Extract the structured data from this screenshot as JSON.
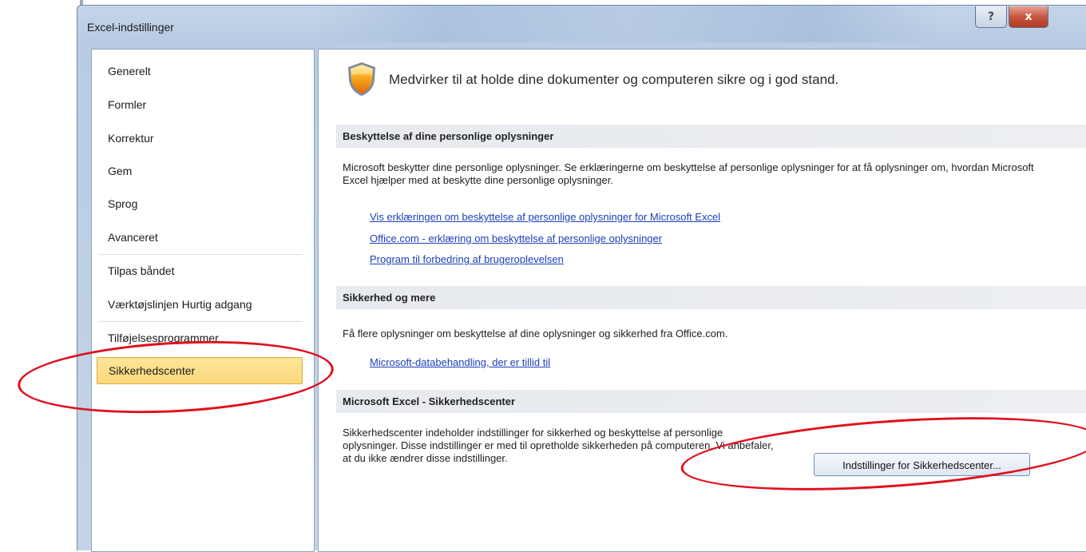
{
  "window": {
    "title": "Excel-indstillinger",
    "help_label": "?",
    "close_label": "x"
  },
  "sidebar": {
    "items": [
      {
        "label": "Generelt"
      },
      {
        "label": "Formler"
      },
      {
        "label": "Korrektur"
      },
      {
        "label": "Gem"
      },
      {
        "label": "Sprog"
      },
      {
        "label": "Avanceret"
      },
      {
        "label": "Tilpas båndet"
      },
      {
        "label": "Værktøjslinjen Hurtig adgang"
      },
      {
        "label": "Tilføjelsesprogrammer"
      },
      {
        "label": "Sikkerhedscenter"
      }
    ],
    "selected": "Sikkerhedscenter"
  },
  "content": {
    "header": "Medvirker til at holde dine dokumenter og computeren sikre og i god stand.",
    "sections": [
      {
        "title": "Beskyttelse af dine personlige oplysninger",
        "text": "Microsoft beskytter dine personlige oplysninger. Se erklæringerne om beskyttelse af personlige oplysninger for at få oplysninger om, hvordan Microsoft Excel hjælper med at beskytte dine personlige oplysninger.",
        "links": [
          "Vis erklæringen om beskyttelse af personlige oplysninger for Microsoft Excel",
          "Office.com - erklæring om beskyttelse af personlige oplysninger",
          "Program til forbedring af brugeroplevelsen"
        ]
      },
      {
        "title": "Sikkerhed og mere",
        "text": "Få flere oplysninger om beskyttelse af dine oplysninger og sikkerhed fra Office.com.",
        "links": [
          "Microsoft-databehandling, der er tillid til"
        ]
      },
      {
        "title": "Microsoft Excel - Sikkerhedscenter",
        "text": "Sikkerhedscenter indeholder indstillinger for sikkerhed og beskyttelse af personlige oplysninger. Disse indstillinger er med til opretholde sikkerheden på computeren. Vi anbefaler, at du ikke ændrer disse indstillinger.",
        "button_label": "Indstillinger for Sikkerhedscenter..."
      }
    ]
  },
  "colors": {
    "link": "#1c3fb7",
    "selected_bg": "#fbd87a",
    "annotation": "#e0101f"
  }
}
